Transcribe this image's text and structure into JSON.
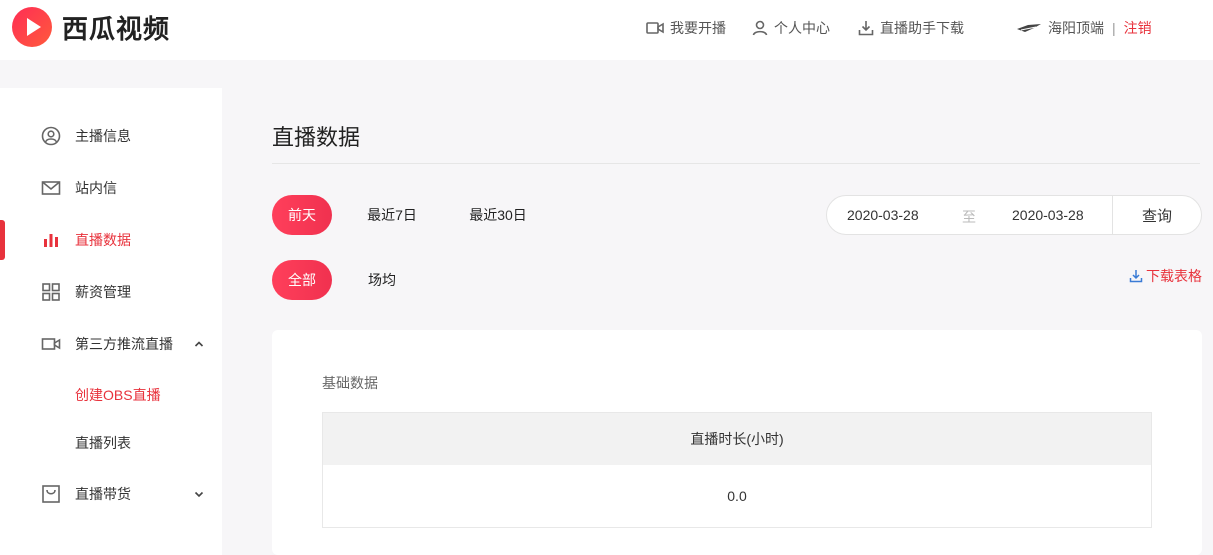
{
  "brand": {
    "name": "西瓜视频",
    "accent": "#e8323c"
  },
  "topnav": {
    "go_live": "我要开播",
    "personal_center": "个人中心",
    "assistant_download": "直播助手下载",
    "username": "海阳顶端",
    "separator": "|",
    "logout": "注销"
  },
  "sidebar": {
    "items": [
      {
        "label": "主播信息",
        "icon": "user-circle-icon"
      },
      {
        "label": "站内信",
        "icon": "mail-icon"
      },
      {
        "label": "直播数据",
        "icon": "bar-chart-icon",
        "active": true
      },
      {
        "label": "薪资管理",
        "icon": "grid-icon"
      },
      {
        "label": "第三方推流直播",
        "icon": "video-camera-icon",
        "expanded": true
      },
      {
        "label": "直播带货",
        "icon": "shopping-bag-icon",
        "expanded": false
      }
    ],
    "subitems": [
      {
        "label": "创建OBS直播",
        "active": true
      },
      {
        "label": "直播列表"
      }
    ]
  },
  "main": {
    "title": "直播数据",
    "range_tabs": [
      "前天",
      "最近7日",
      "最近30日"
    ],
    "range_selected": "前天",
    "scope_tabs": [
      "全部",
      "场均"
    ],
    "scope_selected": "全部",
    "date_start": "2020-03-28",
    "date_to": "至",
    "date_end": "2020-03-28",
    "query_button": "查询",
    "download_label": "下载表格",
    "card": {
      "title": "基础数据",
      "table": {
        "header": "直播时长(小时)",
        "value": "0.0"
      }
    }
  }
}
